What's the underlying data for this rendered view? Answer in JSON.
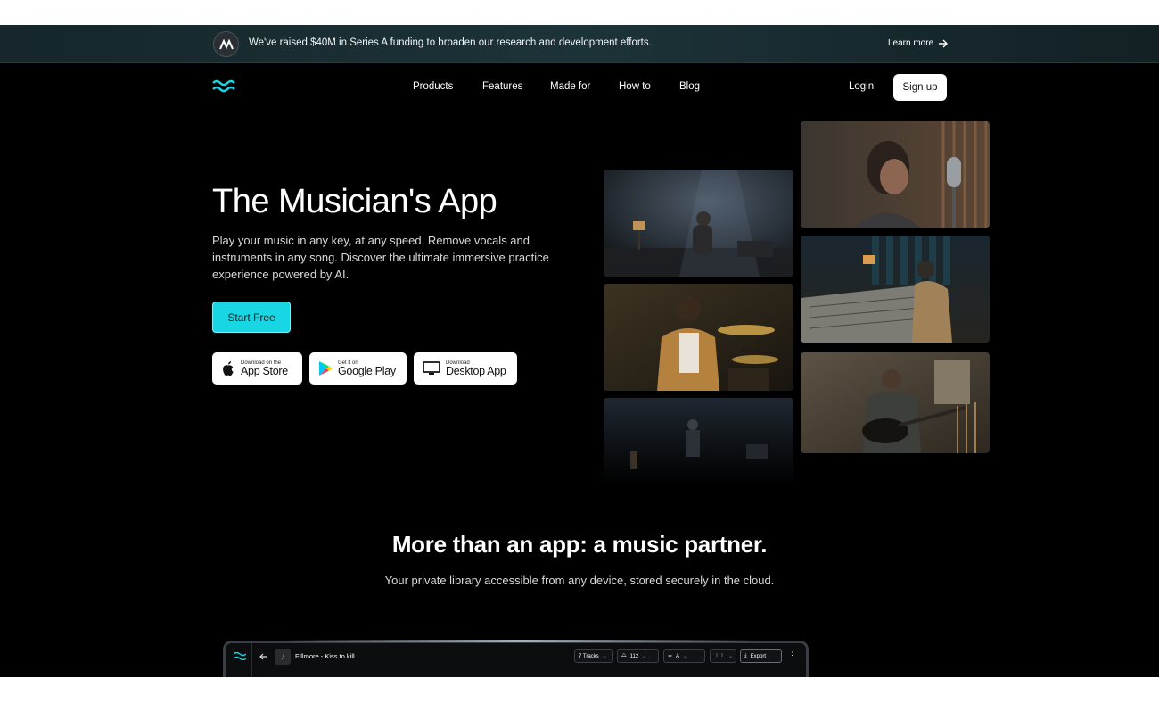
{
  "announcement": {
    "message": "We've raised $40M in Series A funding to broaden our research and development efforts.",
    "link_label": "Learn more"
  },
  "nav": {
    "links": [
      "Products",
      "Features",
      "Made for",
      "How to",
      "Blog"
    ],
    "login": "Login",
    "signup": "Sign up"
  },
  "hero": {
    "title": "The Musician's App",
    "subtitle": "Play your music in any key, at any speed. Remove vocals and instruments in any song. Discover the ultimate immersive practice experience powered by AI.",
    "cta": "Start Free",
    "stores": [
      {
        "small": "Download on the",
        "big": "App Store",
        "icon": "apple-icon"
      },
      {
        "small": "Get it on",
        "big": "Google Play",
        "icon": "google-play-icon"
      },
      {
        "small": "Download",
        "big": "Desktop App",
        "icon": "desktop-icon"
      }
    ]
  },
  "section": {
    "title": "More than an app: a music partner.",
    "subtitle": "Your private library accessible from any device, stored securely in the cloud."
  },
  "app_preview": {
    "song_title": "Fillmore - Kiss to kill",
    "tracks": "7 Tracks",
    "tempo": "112",
    "key": "A",
    "export": "Export"
  },
  "colors": {
    "accent": "#19d6e4",
    "background": "#000000",
    "announce_bg": "#1c3338"
  }
}
